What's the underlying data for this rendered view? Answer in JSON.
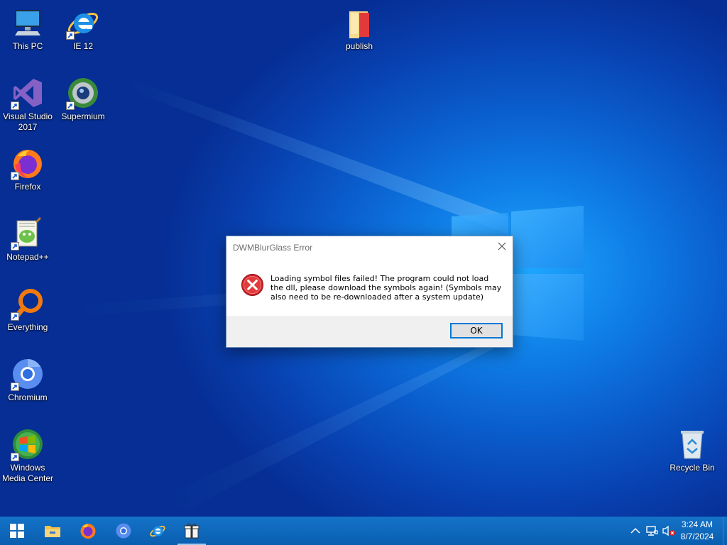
{
  "desktop": {
    "icons": {
      "this_pc": "This PC",
      "ie12": "IE 12",
      "publish": "publish",
      "visual_studio": "Visual Studio 2017",
      "supermium": "Supermium",
      "firefox": "Firefox",
      "notepadpp": "Notepad++",
      "everything": "Everything",
      "chromium": "Chromium",
      "wmc": "Windows Media Center",
      "recycle_bin": "Recycle Bin"
    }
  },
  "dialog": {
    "title": "DWMBlurGlass Error",
    "message": "Loading symbol files failed! The program could not load the dll, please download the symbols again! (Symbols may also need to be re-downloaded after a system update)",
    "ok_label": "OK",
    "icon": "error-icon"
  },
  "taskbar": {
    "pinned": [
      "start-icon",
      "file-explorer-icon",
      "firefox-icon",
      "chromium-icon",
      "internet-explorer-icon",
      "app-gift-icon"
    ],
    "tray": [
      "chevron-up-icon",
      "network-icon",
      "volume-muted-icon"
    ],
    "clock": {
      "time": "3:24 AM",
      "date": "8/7/2024"
    }
  },
  "colors": {
    "taskbar": "#0a5eb0",
    "accent": "#0078d7",
    "error_red": "#d0232b"
  }
}
